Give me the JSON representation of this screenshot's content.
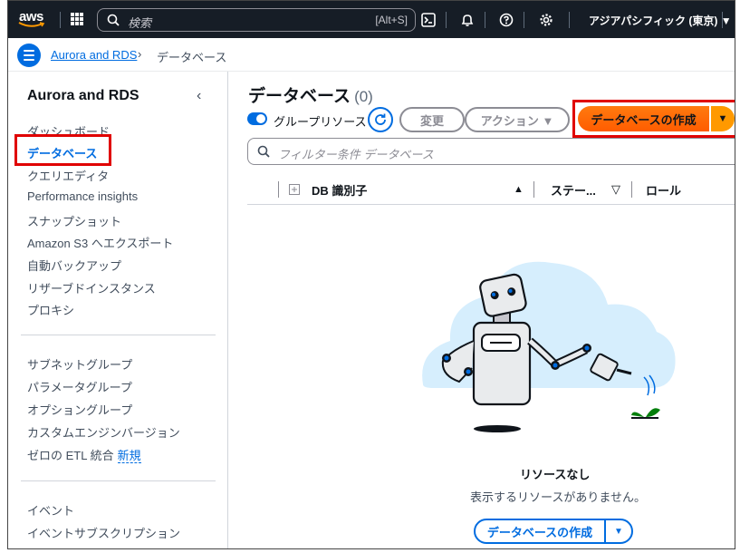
{
  "topbar": {
    "logo": "aws",
    "search_placeholder": "検索",
    "search_shortcut": "[Alt+S]",
    "region": "アジアパシフィック (東京) ▼",
    "icons": [
      "apps-grid-icon",
      "search-icon",
      "cloudshell-icon",
      "bell-icon",
      "help-icon",
      "gear-icon"
    ]
  },
  "breadcrumb": {
    "parent": "Aurora and RDS",
    "separator": "›",
    "current": "データベース"
  },
  "sidenav": {
    "title": "Aurora and RDS",
    "group1": [
      "ダッシュボード",
      "データベース",
      "クエリエディタ",
      "Performance insights",
      "スナップショット",
      "Amazon S3 へエクスポート",
      "自動バックアップ",
      "リザーブドインスタンス",
      "プロキシ"
    ],
    "group2": [
      "サブネットグループ",
      "パラメータグループ",
      "オプショングループ",
      "カスタムエンジンバージョン",
      "ゼロの ETL 統合"
    ],
    "new_badge": "新規",
    "group3": [
      "イベント",
      "イベントサブスクリプション"
    ],
    "active_item": "データベース"
  },
  "main": {
    "title": "データベース",
    "count": "(0)",
    "group_resources_label": "グループリソース",
    "modify_label": "変更",
    "actions_label": "アクション ▼",
    "create_label": "データベースの作成",
    "create_split": "▼",
    "filter_placeholder": "フィルター条件 データベース",
    "columns": [
      "DB 識別子",
      "ステー...",
      "ロール"
    ],
    "sort_asc": "▲",
    "sort_desc": "▽",
    "empty_title": "リソースなし",
    "empty_sub": "表示するリソースがありません。",
    "empty_create_label": "データベースの作成",
    "empty_create_split": "▼"
  },
  "colors": {
    "topbar_bg": "#161d26",
    "link": "#006ce0",
    "primary_button": "#ff7a0f",
    "highlight_box": "#e00000"
  }
}
